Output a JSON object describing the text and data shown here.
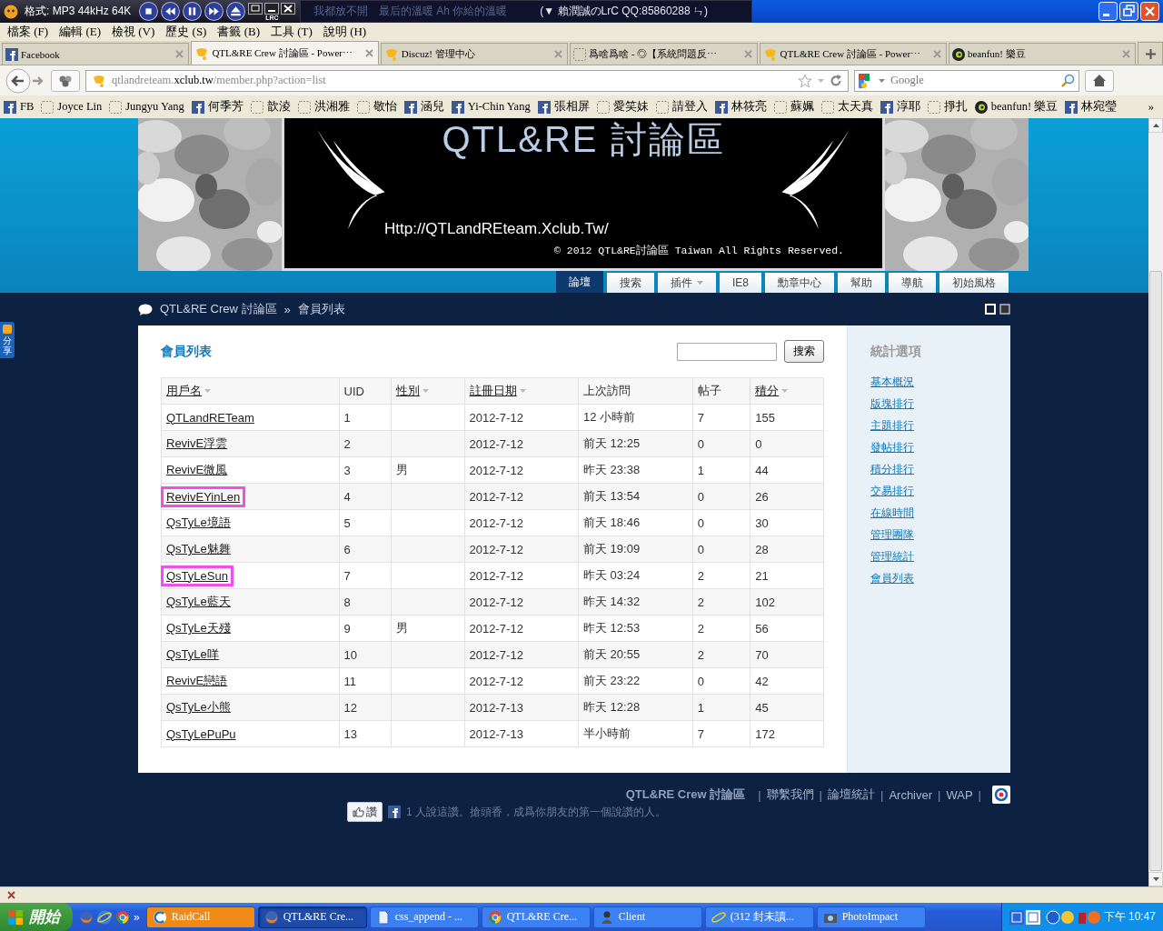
{
  "title_bar": {
    "player_format": "格式: MP3 44kHz 64K",
    "lrc_label": "LRC",
    "lyrics": "我都放不開　最后的溫暖 Ah 你給的溫暖",
    "lyrics_credit": "(▼ 賴潤誠のLrC QQ:85860288 ㄣ)"
  },
  "menu": [
    "檔案 (F)",
    "編輯 (E)",
    "檢視 (V)",
    "歷史 (S)",
    "書籤 (B)",
    "工具 (T)",
    "說明 (H)"
  ],
  "tabs": [
    {
      "label": "Facebook",
      "kind": "facebook",
      "selected": false
    },
    {
      "label": "QTL&RE Crew 討論區 - Power⋯",
      "kind": "discuz",
      "selected": true
    },
    {
      "label": "Discuz! 管理中心",
      "kind": "discuz",
      "selected": false
    },
    {
      "label": "爲啥爲啥 - ◎【系統問題反⋯",
      "kind": "blank",
      "selected": false
    },
    {
      "label": "QTL&RE Crew 討論區 - Power⋯",
      "kind": "discuz",
      "selected": false
    },
    {
      "label": "beanfun! 樂豆",
      "kind": "beanfun",
      "selected": false
    }
  ],
  "address_bar": {
    "url": "qtlandreteam.**xclub.tw**/member.php?action=list"
  },
  "search_box": {
    "placeholder": "Google"
  },
  "bookmarks": [
    {
      "label": "FB",
      "kind": "facebook"
    },
    {
      "label": "Joyce Lin",
      "kind": "blank"
    },
    {
      "label": "Jungyu Yang",
      "kind": "blank"
    },
    {
      "label": "何季芳",
      "kind": "facebook"
    },
    {
      "label": "歆淩",
      "kind": "blank"
    },
    {
      "label": "洪湘雅",
      "kind": "blank"
    },
    {
      "label": "敬怡",
      "kind": "blank"
    },
    {
      "label": "涵兒",
      "kind": "facebook"
    },
    {
      "label": "Yi-Chin Yang",
      "kind": "facebook"
    },
    {
      "label": "張相屏",
      "kind": "facebook"
    },
    {
      "label": "愛笑妹",
      "kind": "blank"
    },
    {
      "label": "請登入",
      "kind": "blank"
    },
    {
      "label": "林筱亮",
      "kind": "facebook"
    },
    {
      "label": "蘇姵",
      "kind": "blank"
    },
    {
      "label": "太天真",
      "kind": "blank"
    },
    {
      "label": "淳耶",
      "kind": "facebook"
    },
    {
      "label": "掙扎",
      "kind": "blank"
    },
    {
      "label": "beanfun! 樂豆",
      "kind": "beanfun"
    },
    {
      "label": "林宛瑩",
      "kind": "facebook"
    }
  ],
  "bookmarks_more": "»",
  "share_tab": "分享",
  "banner": {
    "title": "QTL&RE 討論區",
    "url": "Http://QTLandREteam.Xclub.Tw/",
    "copyright": "© 2012 QTL&RE討論區 Taiwan All Rights Reserved."
  },
  "nav": [
    {
      "label": "論壇",
      "selected": true,
      "dropdown": false
    },
    {
      "label": "搜索",
      "selected": false,
      "dropdown": false
    },
    {
      "label": "插件",
      "selected": false,
      "dropdown": true
    },
    {
      "label": "IE8",
      "selected": false,
      "dropdown": false
    },
    {
      "label": "勳章中心",
      "selected": false,
      "dropdown": false
    },
    {
      "label": "幫助",
      "selected": false,
      "dropdown": false
    },
    {
      "label": "導航",
      "selected": false,
      "dropdown": false
    },
    {
      "label": "初始風格",
      "selected": false,
      "dropdown": false
    }
  ],
  "breadcrumb": {
    "home": "QTL&RE Crew 討論區",
    "separator": "»",
    "current": "會員列表"
  },
  "member_list": {
    "title": "會員列表",
    "search_button": "搜索",
    "columns": [
      {
        "label": "用戶名",
        "sortable": true
      },
      {
        "label": "UID",
        "sortable": false
      },
      {
        "label": "性別",
        "sortable": true
      },
      {
        "label": "註冊日期",
        "sortable": true
      },
      {
        "label": "上次訪問",
        "sortable": false
      },
      {
        "label": "帖子",
        "sortable": false
      },
      {
        "label": "積分",
        "sortable": true
      }
    ],
    "rows": [
      {
        "highlighted": false,
        "cells": [
          "QTLandRETeam",
          "1",
          "",
          "2012-7-12",
          "12 小時前",
          "7",
          "155"
        ]
      },
      {
        "highlighted": false,
        "cells": [
          "RevivE浮雲",
          "2",
          "",
          "2012-7-12",
          "前天 12:25",
          "0",
          "0"
        ]
      },
      {
        "highlighted": false,
        "cells": [
          "RevivE微風",
          "3",
          "男",
          "2012-7-12",
          "昨天 23:38",
          "1",
          "44"
        ]
      },
      {
        "highlighted": true,
        "cells": [
          "RevivEYinLen",
          "4",
          "",
          "2012-7-12",
          "前天 13:54",
          "0",
          "26"
        ]
      },
      {
        "highlighted": false,
        "cells": [
          "QsTyLe境語",
          "5",
          "",
          "2012-7-12",
          "前天 18:46",
          "0",
          "30"
        ]
      },
      {
        "highlighted": false,
        "cells": [
          "QsTyLe魅舞",
          "6",
          "",
          "2012-7-12",
          "前天 19:09",
          "0",
          "28"
        ]
      },
      {
        "highlighted": true,
        "cells": [
          "QsTyLeSun",
          "7",
          "",
          "2012-7-12",
          "昨天 03:24",
          "2",
          "21"
        ]
      },
      {
        "highlighted": false,
        "cells": [
          "QsTyLe藍天",
          "8",
          "",
          "2012-7-12",
          "昨天 14:32",
          "2",
          "102"
        ]
      },
      {
        "highlighted": false,
        "cells": [
          "QsTyLe天殘",
          "9",
          "男",
          "2012-7-12",
          "昨天 12:53",
          "2",
          "56"
        ]
      },
      {
        "highlighted": false,
        "cells": [
          "QsTyLe咩",
          "10",
          "",
          "2012-7-12",
          "前天 20:55",
          "2",
          "70"
        ]
      },
      {
        "highlighted": false,
        "cells": [
          "RevivE戀語",
          "11",
          "",
          "2012-7-12",
          "前天 23:22",
          "0",
          "42"
        ]
      },
      {
        "highlighted": false,
        "cells": [
          "QsTyLe小熊",
          "12",
          "",
          "2012-7-13",
          "昨天 12:28",
          "1",
          "45"
        ]
      },
      {
        "highlighted": false,
        "cells": [
          "QsTyLePuPu",
          "13",
          "",
          "2012-7-13",
          "半小時前",
          "7",
          "172"
        ]
      }
    ]
  },
  "sidebar": {
    "title": "統計選項",
    "links": [
      "基本概況",
      "版塊排行",
      "主題排行",
      "發帖排行",
      "積分排行",
      "交易排行",
      "在線時間",
      "管理團隊",
      "管理統計",
      "會員列表"
    ]
  },
  "footer": {
    "site": "QTL&RE Crew 討論區",
    "items": [
      {
        "kind": "separator",
        "text": "|"
      },
      {
        "kind": "link",
        "text": "聯繫我們"
      },
      {
        "kind": "separator",
        "text": "|"
      },
      {
        "kind": "link",
        "text": "論壇統計"
      },
      {
        "kind": "separator",
        "text": "|"
      },
      {
        "kind": "link",
        "text": "Archiver"
      },
      {
        "kind": "separator",
        "text": "|"
      },
      {
        "kind": "link",
        "text": "WAP"
      },
      {
        "kind": "separator",
        "text": "|"
      }
    ]
  },
  "like": {
    "button": "讚",
    "text": "1 人說這讚。搶頭香，成爲你朋友的第一個說讚的人。"
  },
  "taskbar": {
    "start": "開始",
    "quick_launch_more": "»",
    "items": [
      {
        "label": "RaidCall",
        "kind": "raidcall",
        "selected": false,
        "flashing": true
      },
      {
        "label": "QTL&RE Cre...",
        "kind": "firefox",
        "selected": true,
        "flashing": false
      },
      {
        "label": "css_append - ...",
        "kind": "document",
        "selected": false,
        "flashing": false
      },
      {
        "label": "QTL&RE Cre...",
        "kind": "chrome",
        "selected": false,
        "flashing": false
      },
      {
        "label": "Client",
        "kind": "person",
        "selected": false,
        "flashing": false
      },
      {
        "label": "(312 封未讀...",
        "kind": "ie",
        "selected": false,
        "flashing": false
      },
      {
        "label": "PhotoImpact",
        "selected": false,
        "flashing": false
      }
    ],
    "clock": "下午 10:47"
  }
}
